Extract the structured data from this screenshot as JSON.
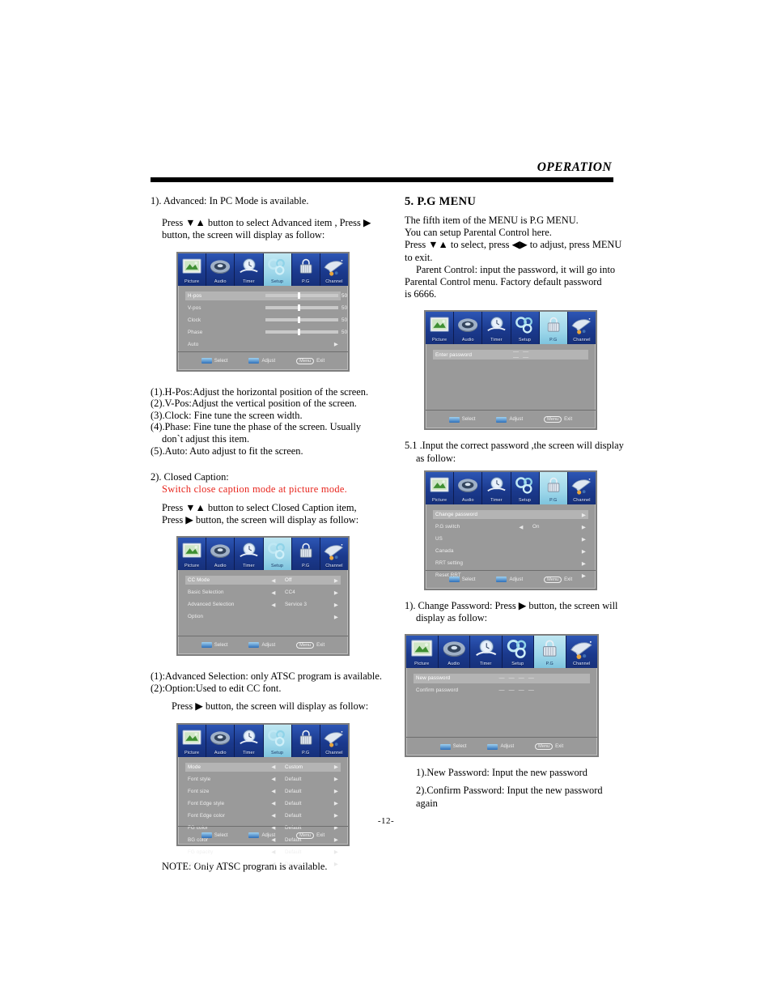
{
  "header": {
    "title": "OPERATION"
  },
  "page_number": "-12-",
  "left_column": {
    "adv_heading": "1). Advanced:  In  PC Mode is  available.",
    "adv_press_1": "Press ▼▲ button to select  Advanced item , Press ▶",
    "adv_press_2": "button, the screen will  display as follow:",
    "adv_list": [
      "(1).H-Pos:Adjust the horizontal position of the screen.",
      "(2).V-Pos:Adjust the vertical position of the screen.",
      "(3).Clock: Fine tune the screen width.",
      "(4).Phase: Fine tune the phase of  the screen. Usually",
      "don`t adjust this item.",
      "(5).Auto: Auto adjust to fit the screen."
    ],
    "cc_heading": "2). Closed  Caption:",
    "cc_red_note": "Switch  close  caption  mode at  picture  mode.",
    "cc_press_1": "Press ▼▲ button to select  Closed  Caption item,",
    "cc_press_2": "Press  ▶ button, the screen will  display as follow:",
    "cc_list": [
      "(1):Advanced Selection: only ATSC program is available.",
      "(2):Option:Used  to edit  CC font."
    ],
    "cc_press_3": "Press  ▶ button, the screen will  display as follow:",
    "note": "NOTE: Only ATSC program is available."
  },
  "right_column": {
    "section_title": "5.  P.G  MENU",
    "intro": [
      "The fifth item of the MENU is P.G MENU.",
      "You can setup Parental Control here.",
      "Press ▼▲ to select, press ◀▶  to adjust, press MENU",
      "to exit.",
      "Parent Control:   input the password, it will  go into",
      "Parental Control  menu. Factory  default password",
      "is 6666."
    ],
    "step_51_line1": "5.1 .Input the correct password ,the screen will display",
    "step_51_line2": "as follow:",
    "change_pw_line1": "1). Change Password: Press ▶ button, the screen will",
    "change_pw_line2": "display as follow:",
    "pw_list": [
      "1).New Password: Input  the  new password",
      "2).Confirm  Password: Input  the new password again"
    ]
  },
  "osd_tabs": [
    {
      "label": "Picture",
      "icon": "picture-icon"
    },
    {
      "label": "Audio",
      "icon": "audio-icon"
    },
    {
      "label": "Timer",
      "icon": "timer-icon"
    },
    {
      "label": "Setup",
      "icon": "setup-icon"
    },
    {
      "label": "P.G",
      "icon": "lock-icon"
    },
    {
      "label": "Channel",
      "icon": "satellite-icon"
    }
  ],
  "osd_footer": {
    "select": "Select",
    "adjust": "Adjust",
    "menu_key": "Menu",
    "exit": "Exit"
  },
  "osd_screens": {
    "advanced": {
      "active_tab": 3,
      "rows": [
        {
          "label": "H-pos",
          "type": "slider",
          "value": "50",
          "highlight": true
        },
        {
          "label": "V-pos",
          "type": "slider",
          "value": "50",
          "highlight": false
        },
        {
          "label": "Clock",
          "type": "slider",
          "value": "50",
          "highlight": false
        },
        {
          "label": "Phase",
          "type": "slider",
          "value": "50",
          "highlight": false
        },
        {
          "label": "Auto",
          "type": "arrow",
          "value": "",
          "highlight": false
        }
      ]
    },
    "closed_caption": {
      "active_tab": 3,
      "rows": [
        {
          "label": "CC  Mode",
          "type": "option",
          "value": "Off",
          "highlight": true
        },
        {
          "label": "Basic Selection",
          "type": "option",
          "value": "CC4",
          "highlight": false
        },
        {
          "label": "Advanced Selection",
          "type": "option",
          "value": "Service 3",
          "highlight": false
        },
        {
          "label": "Option",
          "type": "arrow",
          "value": "",
          "highlight": false
        }
      ]
    },
    "cc_font": {
      "active_tab": 3,
      "rows": [
        {
          "label": "Mode",
          "type": "option",
          "value": "Custom",
          "highlight": true
        },
        {
          "label": "Font style",
          "type": "option",
          "value": "Default",
          "highlight": false
        },
        {
          "label": "Font size",
          "type": "option",
          "value": "Default",
          "highlight": false
        },
        {
          "label": "Font Edge style",
          "type": "option",
          "value": "Default",
          "highlight": false
        },
        {
          "label": "Font Edge color",
          "type": "option",
          "value": "Default",
          "highlight": false
        },
        {
          "label": "FG color",
          "type": "option",
          "value": "Default",
          "highlight": false
        },
        {
          "label": "BG color",
          "type": "option",
          "value": "Default",
          "highlight": false
        },
        {
          "label": "FG opacity",
          "type": "option",
          "value": "Default",
          "highlight": false
        },
        {
          "label": "BG opacity",
          "type": "option",
          "value": "Default",
          "highlight": false
        }
      ]
    },
    "enter_password": {
      "active_tab": 4,
      "rows": [
        {
          "label": "Enter password",
          "type": "dashes",
          "value": "— — — —",
          "highlight": true
        }
      ]
    },
    "pg_menu": {
      "active_tab": 4,
      "rows": [
        {
          "label": "Change password",
          "type": "arrow",
          "value": "",
          "highlight": true
        },
        {
          "label": "P.G switch",
          "type": "option",
          "value": "On",
          "highlight": false
        },
        {
          "label": "US",
          "type": "arrow",
          "value": "",
          "highlight": false
        },
        {
          "label": "Canada",
          "type": "arrow",
          "value": "",
          "highlight": false
        },
        {
          "label": "RRT setting",
          "type": "arrow",
          "value": "",
          "highlight": false
        },
        {
          "label": "Reset RRT",
          "type": "arrow",
          "value": "",
          "highlight": false
        }
      ]
    },
    "change_password": {
      "active_tab": 4,
      "rows": [
        {
          "label": "New password",
          "type": "dashes",
          "value": "— — — —",
          "highlight": true
        },
        {
          "label": "Confirm password",
          "type": "dashes",
          "value": "— — — —",
          "highlight": false
        }
      ]
    }
  }
}
